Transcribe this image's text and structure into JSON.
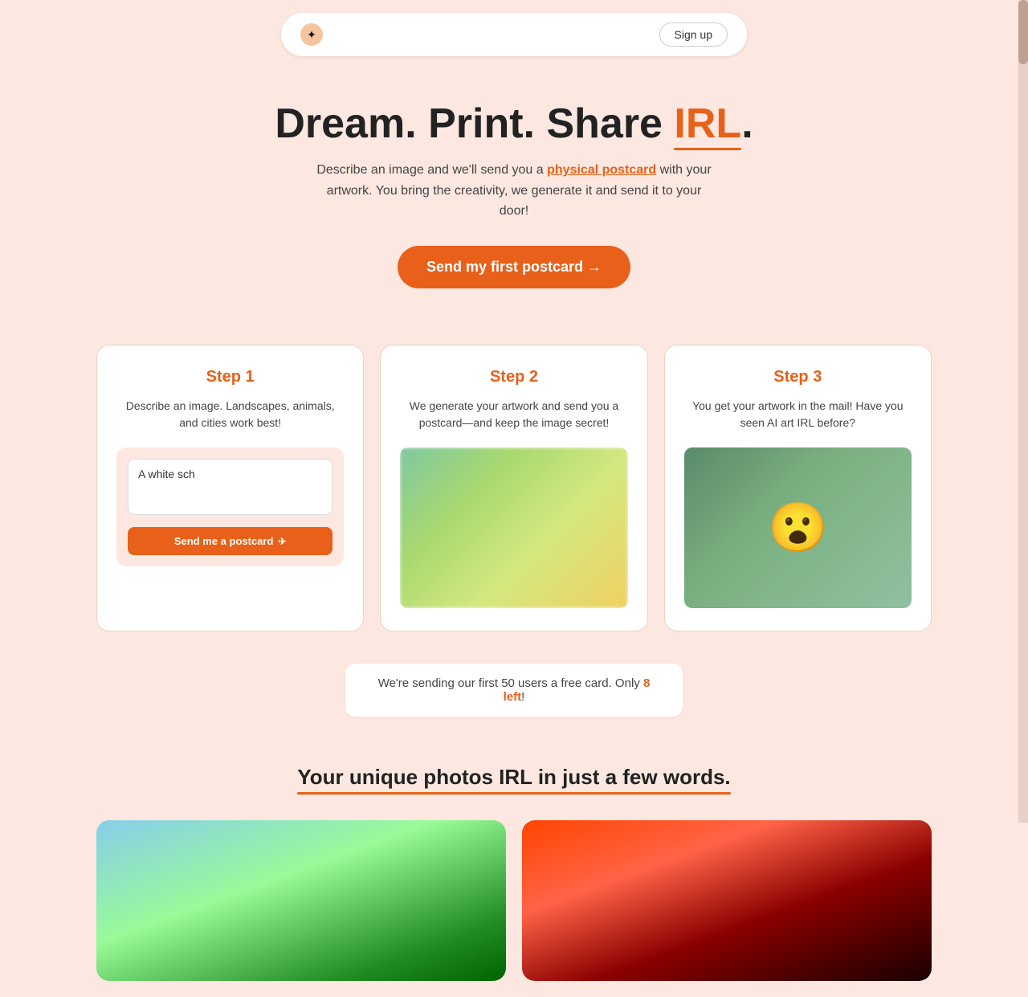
{
  "navbar": {
    "logo_icon": "✦",
    "signup_label": "Sign up"
  },
  "hero": {
    "title_part1": "Dream. Print. Share ",
    "title_irl": "IRL",
    "title_period": ".",
    "subtitle_part1": "Describe an image and we'll send you a ",
    "subtitle_link": "physical postcard",
    "subtitle_part2": " with your artwork. You bring the creativity, we generate it and send it to your door!",
    "cta_label": "Send my first postcard →"
  },
  "steps": [
    {
      "id": "step1",
      "title": "Step 1",
      "description": "Describe an image. Landscapes, animals, and cities work best!",
      "textarea_value": "A white sch",
      "textarea_placeholder": "A white sch",
      "send_btn_label": "Send me a postcard"
    },
    {
      "id": "step2",
      "title": "Step 2",
      "description": "We generate your artwork and send you a postcard—and keep the image secret!"
    },
    {
      "id": "step3",
      "title": "Step 3",
      "description": "You get your artwork in the mail! Have you seen AI art IRL before?"
    }
  ],
  "promo": {
    "text_before": "We're sending our first 50 users a free card. Only ",
    "highlight": "8 left",
    "text_after": "!"
  },
  "bottom": {
    "title": "Your unique photos IRL in just a few words."
  }
}
